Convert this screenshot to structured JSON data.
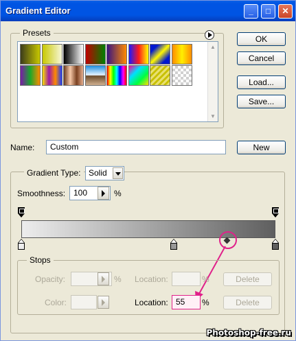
{
  "window": {
    "title": "Gradient Editor"
  },
  "title_buttons": {
    "minimize": "_",
    "maximize": "□",
    "close": "✕"
  },
  "presets": {
    "label": "Presets",
    "swatches": [
      {
        "name": "foreground-to-background",
        "css": "linear-gradient(to right, #3c3c1a, #c8c800)"
      },
      {
        "name": "foreground-to-transparent",
        "css": "linear-gradient(to right, #c8c800, rgba(200,200,0,0.15))"
      },
      {
        "name": "black-white",
        "css": "linear-gradient(to right, #000, #fff)"
      },
      {
        "name": "red-green",
        "css": "linear-gradient(to right, #c00000, #008000)"
      },
      {
        "name": "violet-orange",
        "css": "linear-gradient(to right, #3a1480, #ff8a00)"
      },
      {
        "name": "blue-red-yellow",
        "css": "linear-gradient(to right, #1a1aff, #ff1a1a, #ffff00)"
      },
      {
        "name": "blue-yellow-blue",
        "css": "linear-gradient(135deg, #0018d0 20%, #fff700 50%, #0018d0 80%)"
      },
      {
        "name": "orange-yellow-orange",
        "css": "linear-gradient(to right, #ff8c00, #ffef00, #ff8c00)"
      },
      {
        "name": "violet-green-orange",
        "css": "linear-gradient(to right, #7a1aa8, #1aa82a, #ff8a00)"
      },
      {
        "name": "yellow-violet-orange-blue",
        "css": "linear-gradient(to right, #f7e000, #9d1aa8, #ff8a00, #1a3aff)"
      },
      {
        "name": "copper",
        "css": "linear-gradient(to right, #6b3a1e, #f6c8a8, #7a4020, #e8b090)"
      },
      {
        "name": "chrome",
        "css": "linear-gradient(to bottom, #2090e0, #e8f4ff 48%, #6a4a2a 52%, #d0b090)"
      },
      {
        "name": "spectrum",
        "css": "linear-gradient(to right, #ff0000, #ffff00, #00ff00, #00ffff, #0000ff, #ff00ff, #ff0000)"
      },
      {
        "name": "transparent-rainbow",
        "css": "linear-gradient(135deg, #ff00a0, #00e0ff, #00ff40, #ffe000)"
      },
      {
        "name": "transparent-stripes",
        "css": "repeating-linear-gradient(135deg, #e8e070 0 3px, #c8c000 3px 6px)"
      },
      {
        "name": "transparent-checker",
        "css": "repeating-conic-gradient(#d0d0d0 0 25%, #ffffff 0 50%) 0 0/8px 8px"
      }
    ]
  },
  "buttons": {
    "ok": "OK",
    "cancel": "Cancel",
    "load": "Load...",
    "save": "Save...",
    "new": "New"
  },
  "name": {
    "label": "Name:",
    "value": "Custom"
  },
  "gradient_type": {
    "label": "Gradient Type:",
    "value": "Solid"
  },
  "smoothness": {
    "label": "Smoothness:",
    "value": "100",
    "unit": "%"
  },
  "gradient": {
    "colors": {
      "start": "#ededed",
      "end": "#5f5f5f"
    },
    "opacity_stop_positions": [
      0.0,
      1.0
    ],
    "color_stop_positions": [
      0.0,
      0.6,
      1.0
    ],
    "midpoint_location": 0.81
  },
  "stops": {
    "label": "Stops",
    "opacity_label": "Opacity:",
    "opacity_unit": "%",
    "opacity_location_label": "Location:",
    "opacity_location_unit": "%",
    "opacity_delete": "Delete",
    "color_label": "Color:",
    "location_label": "Location:",
    "location_value": "55",
    "location_unit": "%",
    "delete": "Delete"
  },
  "annotation": {
    "color": "#e0218a"
  },
  "watermark": "Photoshop-free.ru"
}
